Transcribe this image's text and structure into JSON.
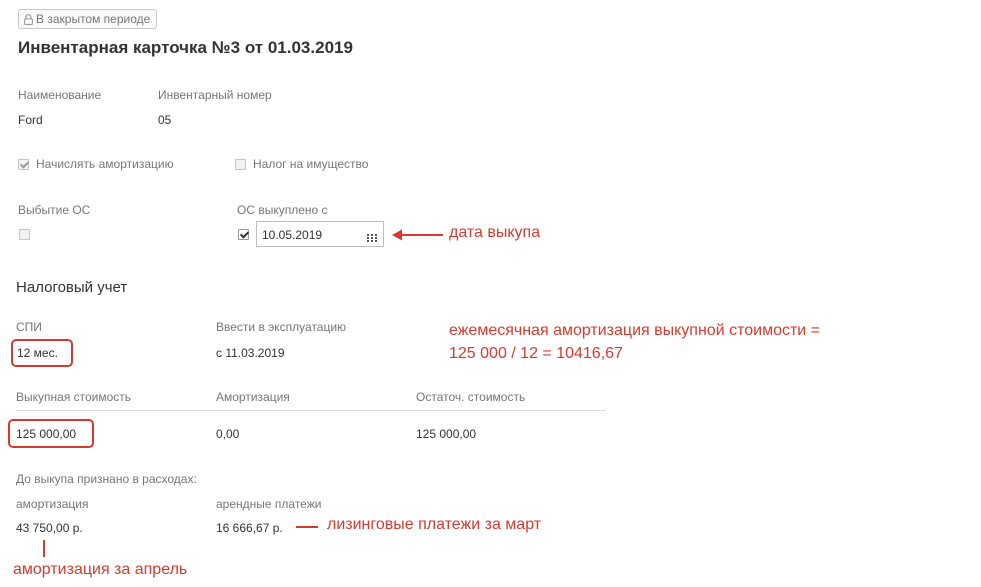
{
  "badge": {
    "label": "В закрытом периоде",
    "icon": "lock-icon"
  },
  "title": "Инвентарная карточка №3 от 01.03.2019",
  "fields": {
    "name_label": "Наименование",
    "name_value": "Ford",
    "inv_label": "Инвентарный номер",
    "inv_value": "05"
  },
  "checkboxes": {
    "depreciation": {
      "label": "Начислять амортизацию",
      "checked": true
    },
    "property_tax": {
      "label": "Налог на имущество",
      "checked": false
    }
  },
  "disposal": {
    "label": "Выбытие ОС",
    "checked": false
  },
  "redeemed": {
    "label": "ОС выкуплено с",
    "checked": true,
    "date": "10.05.2019"
  },
  "tax": {
    "section_title": "Налоговый учет",
    "spi_label": "СПИ",
    "spi_value": "12 мес.",
    "commission_label": "Ввести в эксплуатацию",
    "commission_value": "с 11.03.2019",
    "redemption_cost_label": "Выкупная стоимость",
    "redemption_cost_value": "125 000,00",
    "depreciation_label": "Амортизация",
    "depreciation_value": "0,00",
    "residual_label": "Остаточ. стоимость",
    "residual_value": "125 000,00"
  },
  "before_redemption": {
    "heading": "До выкупа признано в расходах:",
    "amort_label": "амортизация",
    "amort_value": "43 750,00 р.",
    "lease_label": "арендные платежи",
    "lease_value": "16 666,67 р."
  },
  "annotations": {
    "redeem_date": "дата выкупа",
    "monthly_line1": "ежемесячная амортизация выкупной стоимости =",
    "monthly_line2": "125 000 / 12 = 10416,67",
    "lease_march": "лизинговые платежи за март",
    "amort_april": "амортизация за апрель",
    "color": "#d63a2f"
  }
}
